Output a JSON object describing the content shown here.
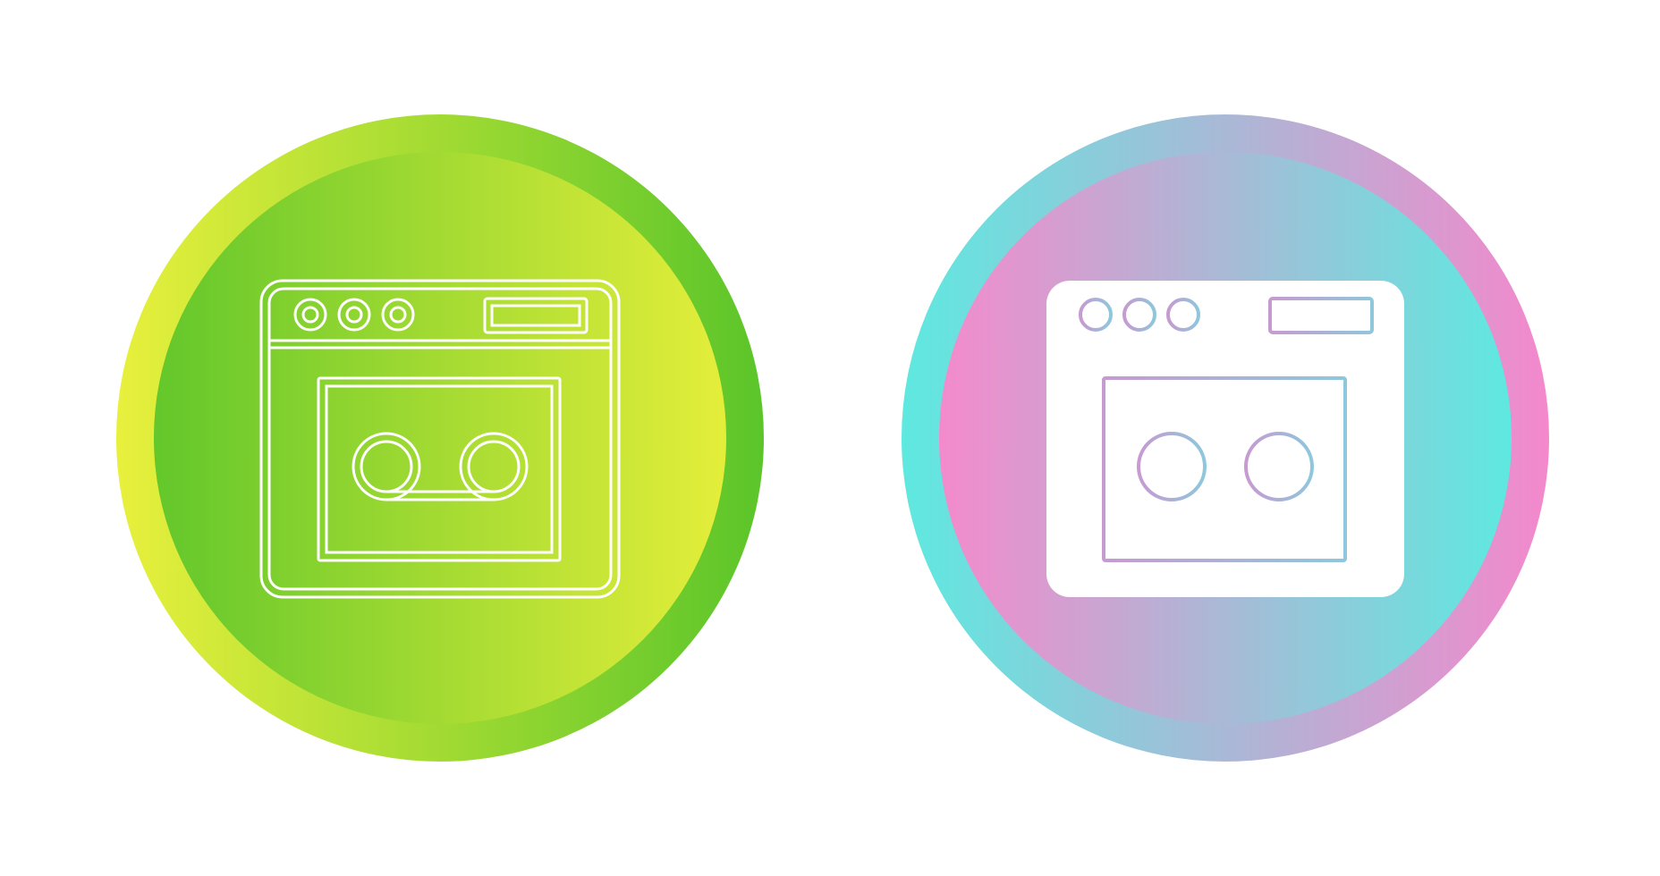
{
  "icons": [
    {
      "name": "voicemail-browser-icon-line",
      "style": "line",
      "ring_gradient": [
        "#e8f03c",
        "#5bc52a"
      ],
      "inner_gradient": [
        "#63c72b",
        "#e4ee3a"
      ],
      "glyph_color": "#ffffff",
      "glyph_fill": "none"
    },
    {
      "name": "voicemail-browser-icon-filled",
      "style": "filled",
      "ring_gradient": [
        "#5ee9e0",
        "#f488cc"
      ],
      "inner_gradient": [
        "#f48acc",
        "#5ee9e0"
      ],
      "glyph_color": "#ffffff",
      "glyph_fill": "#ffffff",
      "detail_gradient": [
        "#c79ad2",
        "#8fc7dc"
      ]
    }
  ]
}
